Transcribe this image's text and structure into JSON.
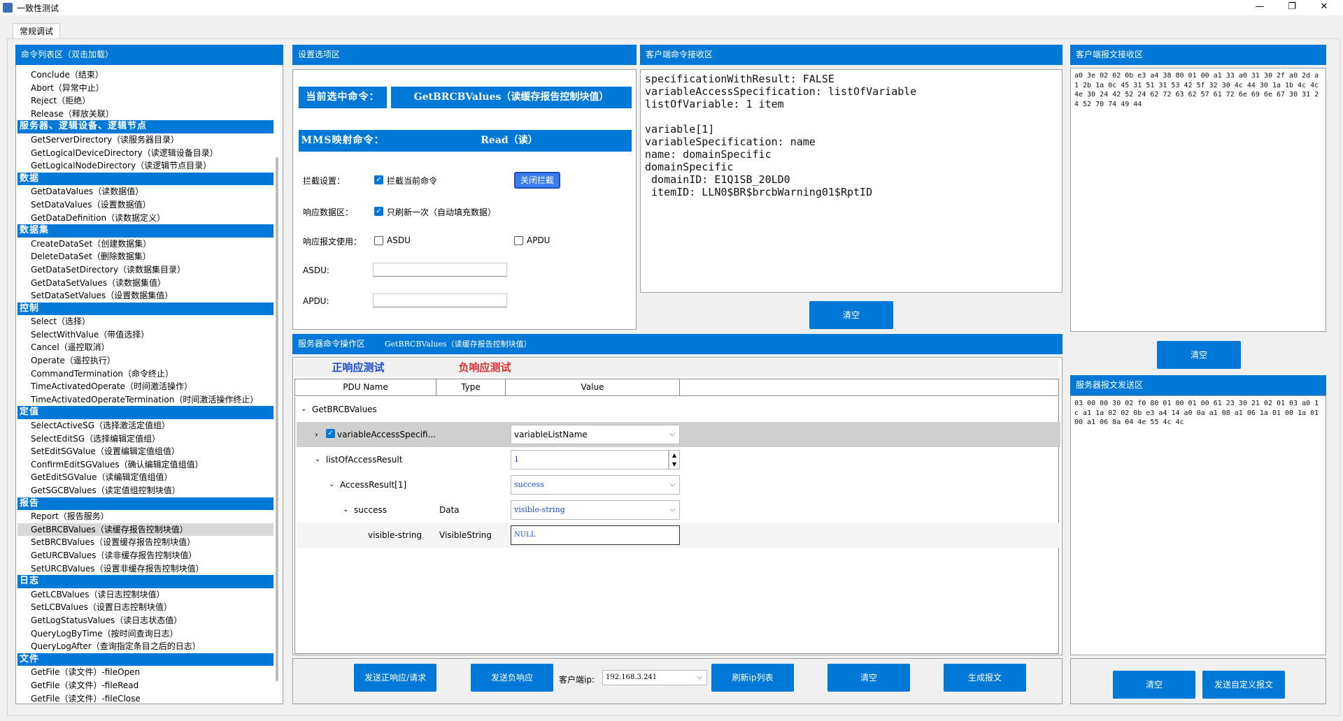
{
  "window": {
    "title": "一致性测试",
    "minimize": "—",
    "maximize": "❐",
    "close": "✕"
  },
  "tabs": {
    "regular": "常规调试"
  },
  "cmdlist": {
    "title": "命令列表区（双击加载）",
    "rows": [
      {
        "t": "item",
        "label": "Conclude（结束）"
      },
      {
        "t": "item",
        "label": "Abort（异常中止）"
      },
      {
        "t": "item",
        "label": "Reject（拒绝）"
      },
      {
        "t": "item",
        "label": "Release（释放关联）"
      },
      {
        "t": "group",
        "label": "服务器、逻辑设备、逻辑节点"
      },
      {
        "t": "item",
        "label": "GetServerDirectory（读服务器目录）"
      },
      {
        "t": "item",
        "label": "GetLogicalDeviceDirectory（读逻辑设备目录）"
      },
      {
        "t": "item",
        "label": "GetLogicalNodeDirectory（读逻辑节点目录）"
      },
      {
        "t": "group",
        "label": "数据"
      },
      {
        "t": "item",
        "label": "GetDataValues（读数据值）"
      },
      {
        "t": "item",
        "label": "SetDataValues（设置数据值）"
      },
      {
        "t": "item",
        "label": "GetDataDefinition（读数据定义）"
      },
      {
        "t": "group",
        "label": "数据集"
      },
      {
        "t": "item",
        "label": "CreateDataSet（创建数据集）"
      },
      {
        "t": "item",
        "label": "DeleteDataSet（删除数据集）"
      },
      {
        "t": "item",
        "label": "GetDataSetDirectory（读数据集目录）"
      },
      {
        "t": "item",
        "label": "GetDataSetValues（读数据集值）"
      },
      {
        "t": "item",
        "label": "SetDataSetValues（设置数据集值）"
      },
      {
        "t": "group",
        "label": "控制"
      },
      {
        "t": "item",
        "label": "Select（选择）"
      },
      {
        "t": "item",
        "label": "SelectWithValue（带值选择）"
      },
      {
        "t": "item",
        "label": "Cancel（遥控取消）"
      },
      {
        "t": "item",
        "label": "Operate（遥控执行）"
      },
      {
        "t": "item",
        "label": "CommandTermination（命令终止）"
      },
      {
        "t": "item",
        "label": "TimeActivatedOperate（时间激活操作）"
      },
      {
        "t": "item",
        "label": "TimeActivatedOperateTermination（时间激活操作终止）"
      },
      {
        "t": "group",
        "label": "定值"
      },
      {
        "t": "item",
        "label": "SelectActiveSG（选择激活定值组）"
      },
      {
        "t": "item",
        "label": "SelectEditSG（选择编辑定值组）"
      },
      {
        "t": "item",
        "label": "SetEditSGValue（设置编辑定值组值）"
      },
      {
        "t": "item",
        "label": "ConfirmEditSGValues（确认编辑定值组值）"
      },
      {
        "t": "item",
        "label": "GetEditSGValue（读编辑定值组值）"
      },
      {
        "t": "item",
        "label": "GetSGCBValues（读定值组控制块值）"
      },
      {
        "t": "group",
        "label": "报告"
      },
      {
        "t": "item",
        "label": "Report（报告服务）"
      },
      {
        "t": "item",
        "label": "GetBRCBValues（读缓存报告控制块值）",
        "selected": true
      },
      {
        "t": "item",
        "label": "SetBRCBValues（设置缓存报告控制块值）"
      },
      {
        "t": "item",
        "label": "GetURCBValues（读非缓存报告控制块值）"
      },
      {
        "t": "item",
        "label": "SetURCBValues（设置非缓存报告控制块值）"
      },
      {
        "t": "group",
        "label": "日志"
      },
      {
        "t": "item",
        "label": "GetLCBValues（读日志控制块值）"
      },
      {
        "t": "item",
        "label": "SetLCBValues（设置日志控制块值）"
      },
      {
        "t": "item",
        "label": "GetLogStatusValues（读日志状态值）"
      },
      {
        "t": "item",
        "label": "QueryLogByTime（按时间查询日志）"
      },
      {
        "t": "item",
        "label": "QueryLogAfter（查询指定条目之后的日志）"
      },
      {
        "t": "group",
        "label": "文件"
      },
      {
        "t": "item",
        "label": "GetFile（读文件）-fileOpen"
      },
      {
        "t": "item",
        "label": "GetFile（读文件）-fileRead"
      },
      {
        "t": "item",
        "label": "GetFile（读文件）-fileClose"
      }
    ]
  },
  "settings": {
    "title": "设置选项区",
    "current_cmd_label": "当前选中命令：",
    "current_cmd_value": "GetBRCBValues（读缓存报告控制块值）",
    "mms_label": "MMS映射命令：",
    "mms_value": "Read（读）",
    "intercept_label": "拦截设置：",
    "intercept_cb": "拦截当前命令",
    "close_intercept_btn": "关闭拦截",
    "resp_area_label": "响应数据区：",
    "resp_area_cb": "只刷新一次（自动填充数据）",
    "resp_use_label": "响应报文使用：",
    "asdu_cb": "ASDU",
    "apdu_cb": "APDU",
    "asdu_label": "ASDU:",
    "apdu_label": "APDU:"
  },
  "client_cmd": {
    "title": "客户端命令接收区",
    "text": "specificationWithResult: FALSE\nvariableAccessSpecification: listOfVariable\nlistOfVariable: 1 item\n\nvariable[1]\nvariableSpecification: name\nname: domainSpecific\ndomainSpecific\n domainID: E1Q1SB_20LD0\n itemID: LLN0$BR$brcbWarning01$RptID",
    "clear_btn": "清空"
  },
  "client_pkt": {
    "title": "客户端报文接收区",
    "hex": "a0 3e 02 02 0b e3 a4 38 80 01 00 a1 33 a0 31 30 2f a0 2d a1 2b 1a 0c 45 31 51 31 53 42 5f 32 30 4c 44 30 1a 1b 4c 4c 4e 30 24 42 52 24 62 72 63 62 57 61 72 6e 69 6e 67 30 31 24 52 70 74 49 44",
    "clear_btn": "清空"
  },
  "server_send": {
    "title": "服务器报文发送区",
    "hex": "03 00 00 30 02 f0 80 01 00 01 00 61 23 30 21 02 01 03 a0 1c a1 1a 02 02 0b e3 a4 14 a0 0a a1 08 a1 06 1a 01 00 1a 01 00 a1 06 8a 04 4e 55 4c 4c",
    "clear_btn": "清空",
    "custom_btn": "发送自定义报文"
  },
  "server_ops": {
    "title": "服务器命令操作区",
    "title_cmd": "GetBRCBValues（读缓存报告控制块值）",
    "tab_positive": "正响应测试",
    "tab_negative": "负响应测试",
    "col_pdu": "PDU Name",
    "col_type": "Type",
    "col_value": "Value",
    "root": "GetBRCBValues",
    "rows": {
      "var_access": "variableAccessSpecifi...",
      "var_access_val": "variableListName",
      "list_access": "listOfAccessResult",
      "list_access_val": "1",
      "access_result": "AccessResult[1]",
      "access_result_val": "success",
      "success": "success",
      "success_type": "Data",
      "success_val": "visible-string",
      "vs": "visible-string",
      "vs_type": "VisibleString",
      "vs_val": "NULL"
    }
  },
  "bottom": {
    "send_pos": "发送正响应/请求",
    "send_neg": "发送负响应",
    "client_ip_label": "客户端ip:",
    "client_ip": "192.168.3.241",
    "refresh_ip": "刷新ip列表",
    "clear": "清空",
    "gen_pkt": "生成报文"
  }
}
